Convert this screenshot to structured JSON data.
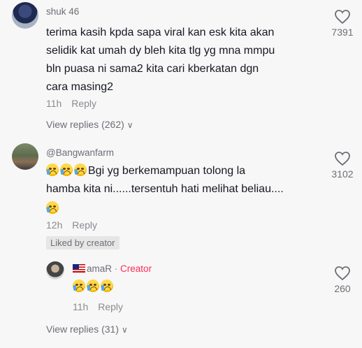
{
  "comments": [
    {
      "username": "shuk 46",
      "text_lines": [
        "terima kasih kpda sapa viral kan esk kita akan",
        "selidik kat umah dy bleh kita tlg yg mna mmpu",
        "bln puasa ni sama2 kita cari kberkatan dgn",
        "cara masing2"
      ],
      "time": "11h",
      "reply_label": "Reply",
      "view_replies": "View replies (262)",
      "likes": "7391"
    },
    {
      "username": "@Bangwanfarm",
      "text_line1": "Bgi yg berkemampuan tolong la",
      "text_line2": "hamba kita ni......tersentuh hati melihat beliau....",
      "time": "12h",
      "reply_label": "Reply",
      "liked_badge": "Liked by creator",
      "likes": "3102"
    }
  ],
  "reply": {
    "username": "amaR",
    "separator": "·",
    "creator_label": "Creator",
    "time": "11h",
    "reply_label": "Reply",
    "likes": "260"
  },
  "footer": {
    "view_replies": "View replies (31)"
  },
  "icons": {
    "like": "heart-outline-icon",
    "emoji": "crying-face-emoji",
    "flag": "malaysia-flag-icon"
  },
  "colors": {
    "creator": "#fe2c55",
    "meta": "#8a8b91"
  }
}
